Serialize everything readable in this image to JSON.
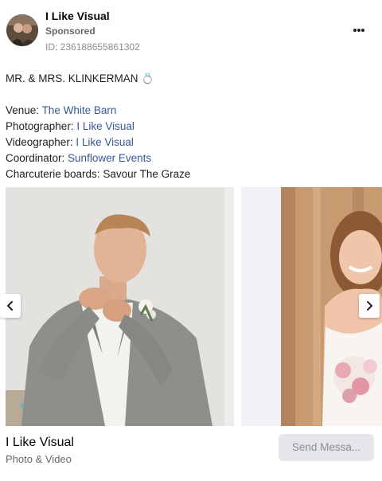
{
  "header": {
    "page_name": "I Like Visual",
    "sponsored": "Sponsored",
    "ad_id": "ID: 236188655861302",
    "more_icon": "more-horizontal-icon"
  },
  "post": {
    "title_line": "MR. & MRS. KLINKERMAN 💍",
    "credits": [
      {
        "label": "Venue: ",
        "value": "The White Barn",
        "is_link": true
      },
      {
        "label": "Photographer: ",
        "value": "I Like Visual",
        "is_link": true
      },
      {
        "label": "Videographer: ",
        "value": "I Like Visual",
        "is_link": true
      },
      {
        "label": "Coordinator: ",
        "value": "Sunflower Events",
        "is_link": true
      },
      {
        "label": "Charcuterie boards: ",
        "value": "Savour The Graze",
        "is_link": false
      }
    ]
  },
  "carousel": {
    "prev_icon": "chevron-left-icon",
    "next_icon": "chevron-right-icon"
  },
  "footer": {
    "title": "I Like Visual",
    "subtitle": "Photo & Video",
    "cta_label": "Send Messa..."
  },
  "colors": {
    "link": "#385898",
    "muted": "#65676b",
    "cta_bg": "#e4e6eb"
  }
}
